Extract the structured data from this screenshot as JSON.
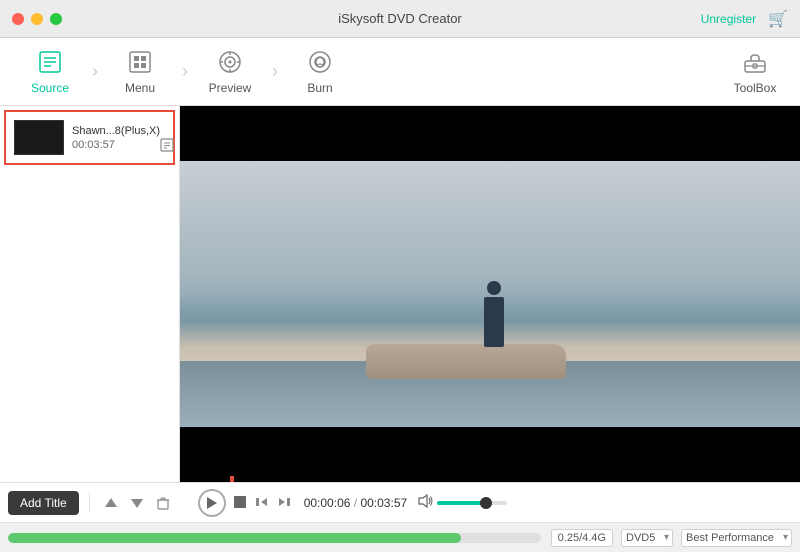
{
  "app": {
    "title": "iSkysoft DVD Creator",
    "unregister_label": "Unregister"
  },
  "titlebar": {
    "buttons": [
      "close",
      "minimize",
      "maximize"
    ]
  },
  "toolbar": {
    "items": [
      {
        "id": "source",
        "label": "Source",
        "active": true
      },
      {
        "id": "menu",
        "label": "Menu",
        "active": false
      },
      {
        "id": "preview",
        "label": "Preview",
        "active": false
      },
      {
        "id": "burn",
        "label": "Burn",
        "active": false
      }
    ],
    "toolbox_label": "ToolBox"
  },
  "sidebar": {
    "files": [
      {
        "name": "Shawn...8(Plus,X)",
        "duration": "00:03:57"
      }
    ]
  },
  "controls": {
    "add_title_label": "Add Title",
    "playback": {
      "current_time": "00:00:06",
      "total_time": "00:03:57",
      "separator": "/"
    }
  },
  "progress": {
    "size_label": "0.25/4.4G",
    "format_label": "DVD5",
    "quality_label": "Best Performance",
    "fill_percent": 85
  }
}
